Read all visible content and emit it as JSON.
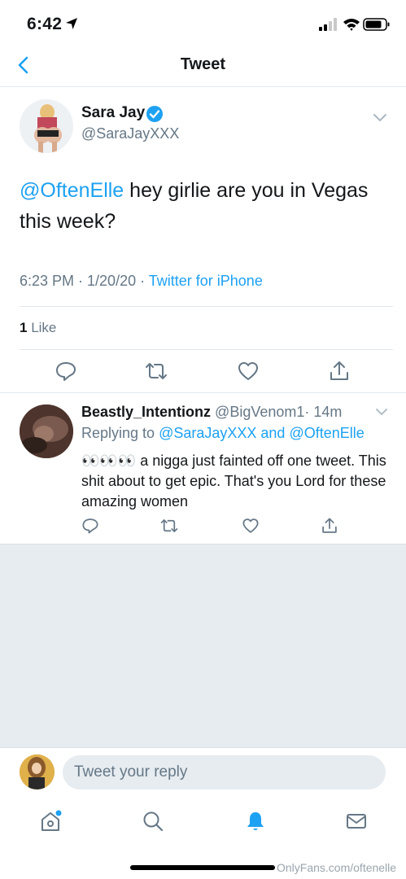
{
  "status_bar": {
    "time": "6:42"
  },
  "nav": {
    "title": "Tweet"
  },
  "tweet": {
    "author_name": "Sara Jay",
    "author_handle": "@SaraJayXXX",
    "mention": "@OftenElle",
    "text_line1": " hey girlie are you in Vegas",
    "text_line2": "this week?",
    "timestamp": "6:23 PM · 1/20/20 · ",
    "source": "Twitter for iPhone",
    "likes_count": "1",
    "likes_label": " Like"
  },
  "reply": {
    "author_name": "Beastly_Intentionz",
    "author_handle": "@BigVenom1",
    "time": "· 14m",
    "replying_prefix": "Replying to ",
    "replying_to_1": "@SaraJayXXX",
    "replying_and": " and ",
    "replying_to_2": "@OftenElle",
    "text": "👀👀👀 a nigga just fainted off one tweet. This shit about to get epic. That's you Lord for these amazing women"
  },
  "composer": {
    "placeholder": "Tweet your reply"
  },
  "watermark": "OnlyFans.com/oftenelle",
  "colors": {
    "accent": "#1da1f2",
    "muted": "#657786",
    "background_gray": "#e6ecf0"
  },
  "icons": [
    "location-arrow-icon",
    "signal-icon",
    "wifi-icon",
    "battery-icon",
    "back-chevron-icon",
    "verified-badge-icon",
    "chevron-down-icon",
    "reply-icon",
    "retweet-icon",
    "like-icon",
    "share-icon",
    "home-icon",
    "search-icon",
    "notifications-bell-icon",
    "messages-icon"
  ]
}
